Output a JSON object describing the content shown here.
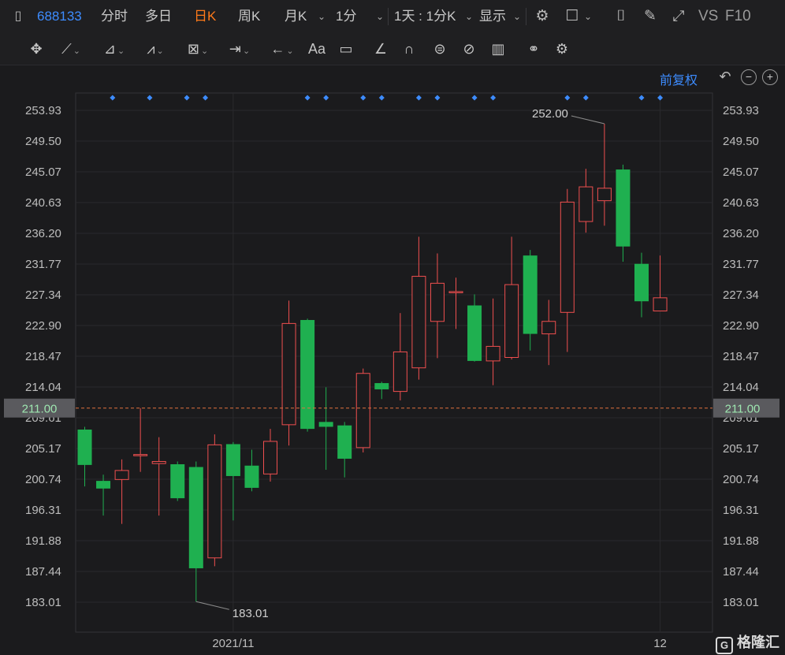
{
  "topbar": {
    "code": "688133",
    "tabs": [
      "分时",
      "多日",
      "日K",
      "周K",
      "月K",
      "1分"
    ],
    "active_tab": "日K",
    "period": "1天 : 1分K",
    "display": "显示",
    "vs": "VS",
    "f10": "F10"
  },
  "toolbar": {
    "text_tool": "Aa"
  },
  "chart_controls": {
    "adjust": "前复权"
  },
  "brand": {
    "name": "格隆汇",
    "mark": "G"
  },
  "colors": {
    "up": "#ef4f4f",
    "down": "#1fb050",
    "accent": "#3d8cff",
    "active_tab": "#ff7a1a",
    "price_line": "#e0733e"
  },
  "chart_data": {
    "type": "candlestick",
    "y_ticks": [
      "253.93",
      "249.50",
      "245.07",
      "240.63",
      "236.20",
      "231.77",
      "227.34",
      "222.90",
      "218.47",
      "214.04",
      "209.61",
      "205.17",
      "200.74",
      "196.31",
      "191.88",
      "187.44",
      "183.01"
    ],
    "ylim": [
      183.01,
      253.93
    ],
    "x_labels": [
      {
        "index": 8,
        "label": "2021/11"
      },
      {
        "index": 31,
        "label": "12"
      }
    ],
    "current_price": "211.00",
    "annotations": [
      {
        "index": 28,
        "text": "252.00",
        "kind": "high"
      },
      {
        "index": 6,
        "text": "183.01",
        "kind": "low"
      }
    ],
    "event_marker_indices": [
      1.5,
      3.5,
      5.5,
      6.5,
      12,
      13,
      15,
      16,
      18,
      19,
      21,
      22,
      26,
      27,
      30,
      31
    ],
    "candles": [
      {
        "o": 207.9,
        "c": 202.8,
        "h": 208.3,
        "l": 199.7
      },
      {
        "o": 200.5,
        "c": 199.4,
        "h": 201.4,
        "l": 195.5
      },
      {
        "o": 200.7,
        "c": 202.0,
        "h": 203.6,
        "l": 194.3
      },
      {
        "o": 204.3,
        "c": 204.3,
        "h": 211.0,
        "l": 201.8
      },
      {
        "o": 203.0,
        "c": 203.3,
        "h": 206.8,
        "l": 195.5
      },
      {
        "o": 202.9,
        "c": 198.0,
        "h": 203.3,
        "l": 197.6
      },
      {
        "o": 202.5,
        "c": 187.9,
        "h": 203.3,
        "l": 183.1
      },
      {
        "o": 189.4,
        "c": 205.7,
        "h": 207.2,
        "l": 188.2
      },
      {
        "o": 205.8,
        "c": 201.2,
        "h": 206.1,
        "l": 194.8
      },
      {
        "o": 202.7,
        "c": 199.5,
        "h": 205.0,
        "l": 199.0
      },
      {
        "o": 201.5,
        "c": 206.2,
        "h": 208.0,
        "l": 200.4
      },
      {
        "o": 208.6,
        "c": 223.2,
        "h": 226.5,
        "l": 205.6
      },
      {
        "o": 223.7,
        "c": 208.0,
        "h": 223.9,
        "l": 207.6
      },
      {
        "o": 209.0,
        "c": 208.3,
        "h": 214.0,
        "l": 202.1
      },
      {
        "o": 208.5,
        "c": 203.7,
        "h": 209.0,
        "l": 201.0
      },
      {
        "o": 205.3,
        "c": 216.0,
        "h": 216.7,
        "l": 204.6
      },
      {
        "o": 214.6,
        "c": 213.7,
        "h": 214.8,
        "l": 212.3
      },
      {
        "o": 213.4,
        "c": 219.1,
        "h": 224.7,
        "l": 212.1
      },
      {
        "o": 216.8,
        "c": 230.0,
        "h": 235.7,
        "l": 215.1
      },
      {
        "o": 223.5,
        "c": 229.0,
        "h": 233.3,
        "l": 218.2
      },
      {
        "o": 227.8,
        "c": 227.8,
        "h": 229.8,
        "l": 222.4
      },
      {
        "o": 225.8,
        "c": 217.8,
        "h": 227.4,
        "l": 217.7
      },
      {
        "o": 217.8,
        "c": 219.9,
        "h": 226.8,
        "l": 214.3
      },
      {
        "o": 218.3,
        "c": 228.8,
        "h": 235.7,
        "l": 218.0
      },
      {
        "o": 233.0,
        "c": 221.7,
        "h": 233.8,
        "l": 219.3
      },
      {
        "o": 221.7,
        "c": 223.5,
        "h": 226.6,
        "l": 217.2
      },
      {
        "o": 224.8,
        "c": 240.7,
        "h": 242.6,
        "l": 219.1
      },
      {
        "o": 237.9,
        "c": 242.9,
        "h": 245.5,
        "l": 236.3
      },
      {
        "o": 240.9,
        "c": 242.7,
        "h": 252.0,
        "l": 237.3
      },
      {
        "o": 245.4,
        "c": 234.3,
        "h": 246.1,
        "l": 232.1
      },
      {
        "o": 231.8,
        "c": 226.4,
        "h": 233.4,
        "l": 224.1
      },
      {
        "o": 225.0,
        "c": 226.9,
        "h": 233.0,
        "l": 225.0
      }
    ]
  }
}
